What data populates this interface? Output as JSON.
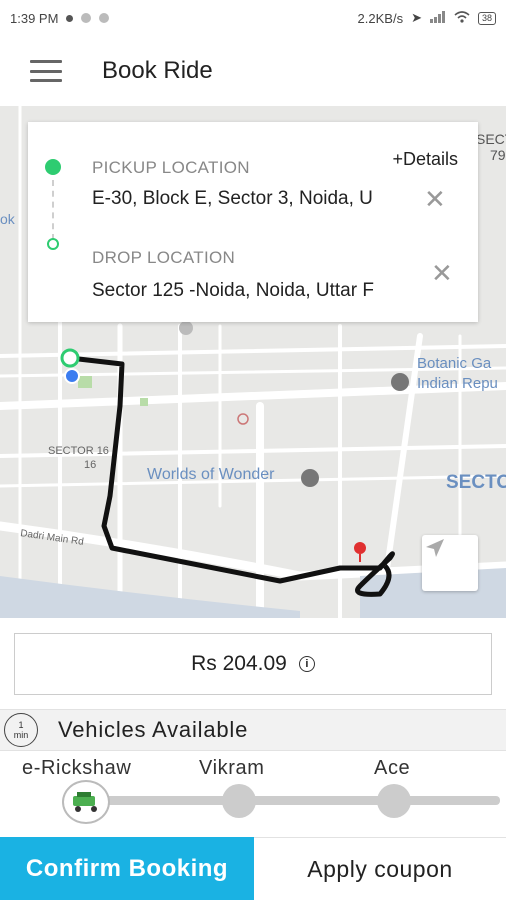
{
  "status_bar": {
    "time": "1:39 PM",
    "network_speed": "2.2KB/s",
    "battery": "38"
  },
  "app_bar": {
    "title": "Book Ride"
  },
  "map": {
    "labels": {
      "sector_top_right": "SECTOR",
      "sector_top_right_num": "79",
      "left_edge": "ok",
      "botanic": "Botanic Ga",
      "indian_rep": "Indian Repu",
      "sector_16": "SECTOR 16",
      "sector_16_num": "16",
      "worlds_of_wonder": "Worlds of Wonder",
      "sector_right": "SECTO",
      "dadri_road": "Dadri Main Rd"
    }
  },
  "location_card": {
    "pickup_label": "PICKUP LOCATION",
    "pickup_value": "E-30, Block E, Sector 3, Noida, U",
    "drop_label": "DROP LOCATION",
    "drop_value": "Sector 125 -Noida, Noida, Uttar F",
    "details_link": "+Details"
  },
  "fare": {
    "amount": "Rs 204.09"
  },
  "vehicles": {
    "eta_top": "1",
    "eta_bottom": "min",
    "title": "Vehicles Available",
    "options": [
      "e-Rickshaw",
      "Vikram",
      "Ace"
    ]
  },
  "actions": {
    "confirm": "Confirm Booking",
    "coupon": "Apply coupon"
  },
  "colors": {
    "accent": "#1ab2e3",
    "pickup_green": "#2ecc71",
    "route": "#111111"
  }
}
